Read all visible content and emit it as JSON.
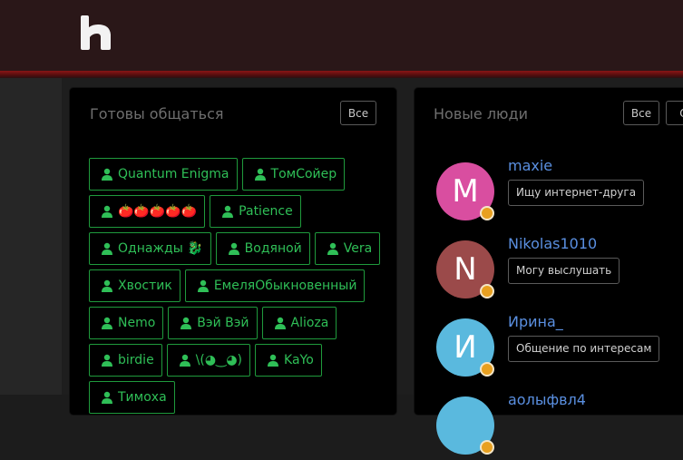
{
  "header": {
    "logo_letter": "h"
  },
  "ready": {
    "title": "Готовы общаться",
    "all_label": "Все",
    "users": [
      "Quantum Enigma",
      "ТомСойер",
      "🍅🍅🍅🍅🍅",
      "Patience",
      "Однажды 🐉",
      "Водяной",
      "Vera",
      "Хвостик",
      "ЕмеляОбыкновенный",
      "Nemo",
      "Вэй Вэй",
      "Alioza",
      "birdie",
      "\\(◕‿◕)",
      "KaYo",
      "Тимоха"
    ]
  },
  "newpeople": {
    "title": "Новые люди",
    "all_label": "Все",
    "second_label": "О",
    "people": [
      {
        "initial": "M",
        "name": "maxie",
        "tag": "Ищу интернет-друга",
        "color": "#d94ea0"
      },
      {
        "initial": "N",
        "name": "Nikolas1010",
        "tag": "Могу выслушать",
        "color": "#9b4a4a"
      },
      {
        "initial": "И",
        "name": "Ирина_",
        "tag": "Общение по интересам",
        "color": "#5ab9de"
      },
      {
        "initial": "",
        "name": "аолыфвл4",
        "tag": "",
        "color": "#5ab9de"
      }
    ]
  },
  "colors": {
    "accent_green": "#2fbf57",
    "link_blue": "#5a8fe0",
    "header_bg": "#2a1718",
    "header_stripe": "#8a1515",
    "status_dot": "#e8a020"
  },
  "icons": {
    "chip_icon": "user-icon",
    "logo": "h-logo-icon"
  }
}
